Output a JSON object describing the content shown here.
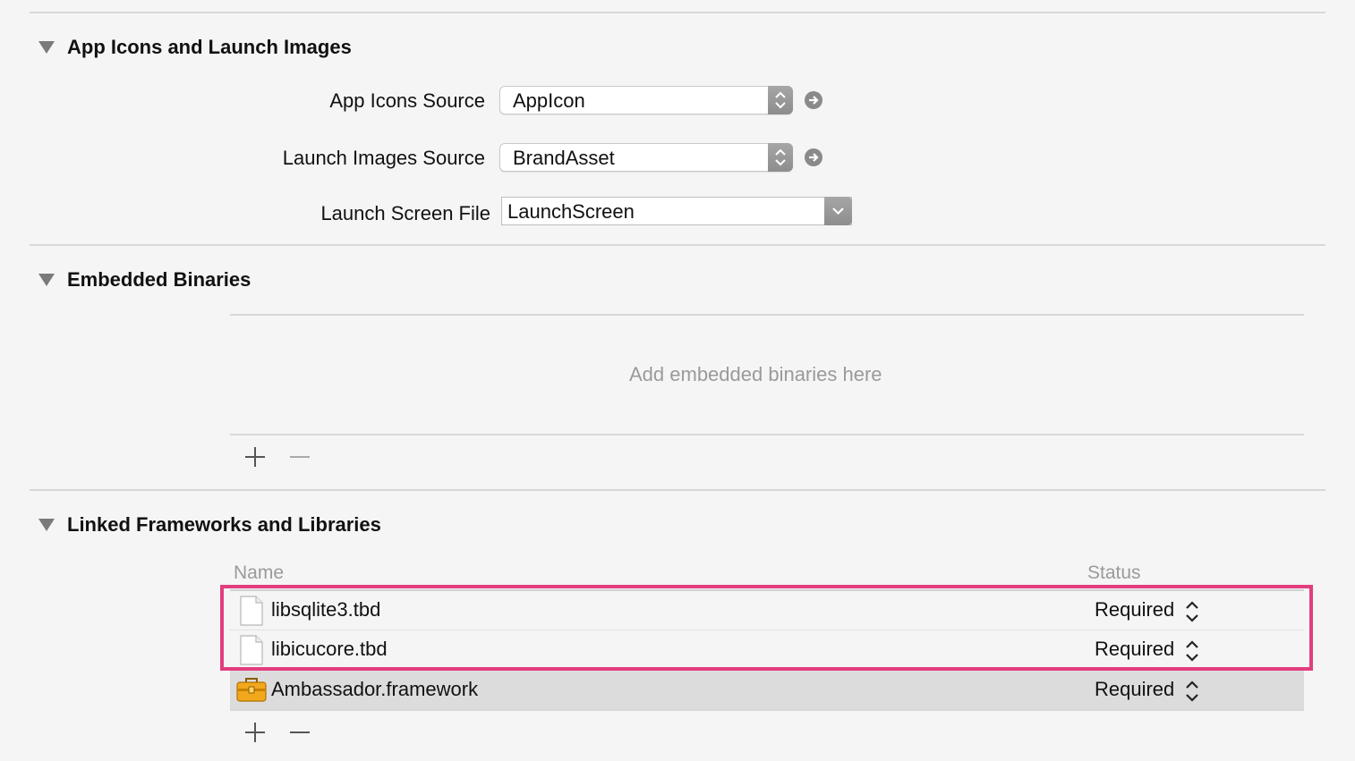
{
  "sections": {
    "app_icons": {
      "title": "App Icons and Launch Images",
      "fields": {
        "app_icons_source": {
          "label": "App Icons Source",
          "value": "AppIcon"
        },
        "launch_images_source": {
          "label": "Launch Images Source",
          "value": "BrandAsset"
        },
        "launch_screen_file": {
          "label": "Launch Screen File",
          "value": "LaunchScreen"
        }
      }
    },
    "embedded_binaries": {
      "title": "Embedded Binaries",
      "placeholder": "Add embedded binaries here"
    },
    "linked_frameworks": {
      "title": "Linked Frameworks and Libraries",
      "columns": {
        "name": "Name",
        "status": "Status"
      },
      "rows": [
        {
          "name": "libsqlite3.tbd",
          "status": "Required",
          "icon": "file-icon"
        },
        {
          "name": "libicucore.tbd",
          "status": "Required",
          "icon": "file-icon"
        },
        {
          "name": "Ambassador.framework",
          "status": "Required",
          "icon": "toolbox-icon"
        }
      ]
    }
  },
  "colors": {
    "highlight": "#e23e7d",
    "selected_row": "#dcdcdc",
    "background": "#f5f5f5"
  }
}
